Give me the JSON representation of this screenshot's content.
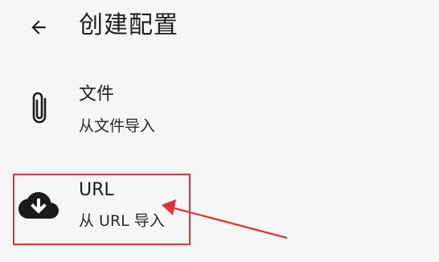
{
  "header": {
    "title": "创建配置",
    "back_icon": "arrow-left-icon"
  },
  "items": [
    {
      "icon": "paperclip-icon",
      "label": "文件",
      "sublabel": "从文件导入"
    },
    {
      "icon": "cloud-download-icon",
      "label": "URL",
      "sublabel": "从 URL 导入"
    }
  ],
  "annotation": {
    "color": "#e0333b"
  }
}
